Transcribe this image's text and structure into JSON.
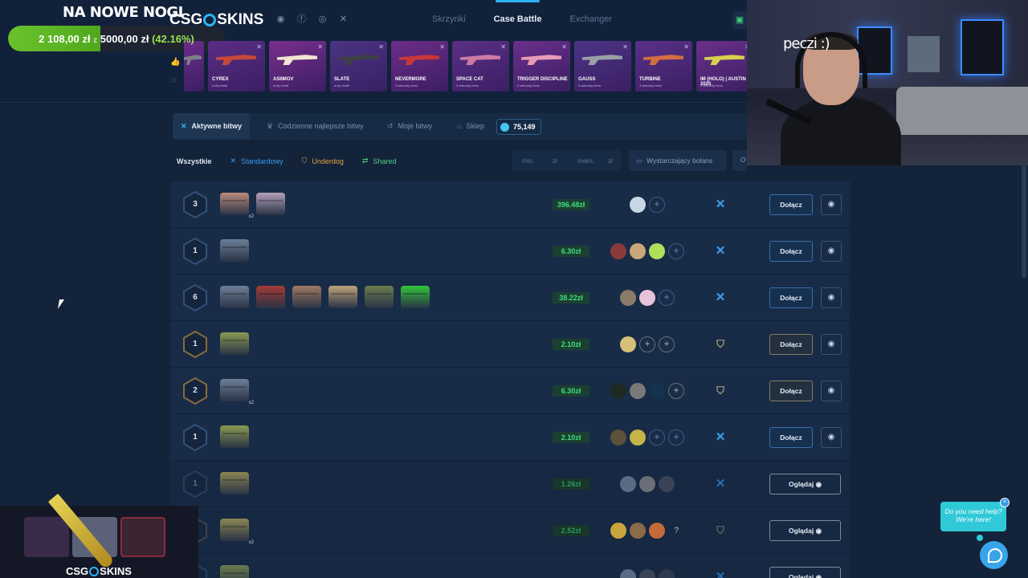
{
  "goal": {
    "title": "NA NOWE NOGI",
    "current": "2 108,00 zł",
    "of": "z",
    "target": "5000,00 zł",
    "percent": "(42.16%)",
    "fraction": 0.4216
  },
  "brand": {
    "left": "CSG",
    "right": "SKINS"
  },
  "socials": [
    "discord-icon",
    "facebook-icon",
    "instagram-icon",
    "x-icon"
  ],
  "nav": {
    "cases": "Skrzynki",
    "case_battle": "Case Battle",
    "exchanger": "Exchanger"
  },
  "drops": [
    {
      "name": "",
      "sub": "",
      "color": "#6d2c8c",
      "gun": "#7b7f86"
    },
    {
      "name": "CYREX",
      "sub": "w tej chwili",
      "color": "#5b2d86",
      "gun": "#c54a3a"
    },
    {
      "name": "ASIIMOV",
      "sub": "w tej chwili",
      "color": "#7a2e8d",
      "gun": "#f0e6d2"
    },
    {
      "name": "SLATE",
      "sub": "w tej chwili",
      "color": "#4a3483",
      "gun": "#3d4147"
    },
    {
      "name": "NEVERMORE",
      "sub": "3 sekundy temu",
      "color": "#6e2c88",
      "gun": "#c8373a"
    },
    {
      "name": "SPACE CAT",
      "sub": "3 sekundy temu",
      "color": "#5c2f87",
      "gun": "#d07aa6"
    },
    {
      "name": "TRIGGER DISCIPLINE",
      "sub": "3 sekundy temu",
      "color": "#6a2f8c",
      "gun": "#e89bb6"
    },
    {
      "name": "GAUSS",
      "sub": "3 sekundy temu",
      "color": "#4e3386",
      "gun": "#9aa0a8"
    },
    {
      "name": "TURBINE",
      "sub": "3 sekundy temu",
      "color": "#5a3188",
      "gun": "#d36d42"
    },
    {
      "name": "IM (HOLO) | AUSTIN 2025",
      "sub": "3 sekundy temu",
      "color": "#6c2f8c",
      "gun": "#d7d14d"
    }
  ],
  "tabs": {
    "active": "Aktywne bitwy",
    "daily": "Codzienne najlepsze bitwy",
    "mine": "Moje bitwy",
    "shop": "Sklep",
    "coins": "75,149"
  },
  "filters": {
    "all": "Wszystkie",
    "standard": "Standardowy",
    "underdog": "Underdog",
    "shared": "Shared",
    "min_placeholder": "min.",
    "max_placeholder": "maks.",
    "currency": "zł",
    "balance": "Wystarczający bolans",
    "edge_label": "O"
  },
  "colors": {
    "accent": "#2db4f2",
    "price": "#3ddf7c",
    "standard": "#3e9ef2",
    "underdog": "#e0a544",
    "shared": "#4bd486"
  },
  "battles": [
    {
      "rounds": "3",
      "ring": "#34507a",
      "cases": [
        {
          "c": "#b98c7c",
          "m": "x2"
        },
        {
          "c": "#b3a0b8",
          "m": ""
        }
      ],
      "price": "396.48zł",
      "players": [
        "#c8d6e6"
      ],
      "slots": 1,
      "mode": "std",
      "action": "Dołącz",
      "dim": false
    },
    {
      "rounds": "1",
      "ring": "#34507a",
      "cases": [
        {
          "c": "#6c7f98",
          "m": ""
        }
      ],
      "price": "6.30zł",
      "players": [
        "#8a3a3a",
        "#c9a77a",
        "#aee05c"
      ],
      "slots": 1,
      "mode": "std",
      "action": "Dołącz",
      "dim": false
    },
    {
      "rounds": "6",
      "ring": "#34507a",
      "cases": [
        {
          "c": "#6c7f98",
          "m": ""
        },
        {
          "c": "#a43a35",
          "m": ""
        },
        {
          "c": "#a27a64",
          "m": ""
        },
        {
          "c": "#c0a37a",
          "m": ""
        },
        {
          "c": "#6b7d4e",
          "m": ""
        },
        {
          "c": "#32c53a",
          "m": ""
        }
      ],
      "price": "38.22zł",
      "players": [
        "#8b7b6a",
        "#e6c3d8"
      ],
      "slots": 1,
      "mode": "std",
      "action": "Dołącz",
      "dim": false
    },
    {
      "rounds": "1",
      "ring": "#8a6a3c",
      "cases": [
        {
          "c": "#8a9a52",
          "m": ""
        }
      ],
      "price": "2.10zł",
      "players": [
        "#d6c07a"
      ],
      "slots": 2,
      "mode": "und",
      "action": "Dołącz",
      "dim": false
    },
    {
      "rounds": "2",
      "ring": "#8a6a3c",
      "cases": [
        {
          "c": "#6c7f98",
          "m": "x2"
        }
      ],
      "price": "6.30zł",
      "players": [
        "#1d2a22",
        "#7c7a78",
        "#12324e"
      ],
      "slots": 1,
      "mode": "und",
      "action": "Dołącz",
      "dim": false
    },
    {
      "rounds": "1",
      "ring": "#34507a",
      "cases": [
        {
          "c": "#8a9a52",
          "m": ""
        }
      ],
      "price": "2.10zł",
      "players": [
        "#5c513a",
        "#c5b446"
      ],
      "slots": 2,
      "mode": "std",
      "action": "Dołącz",
      "dim": false
    },
    {
      "rounds": "1",
      "ring": "#27405f",
      "cases": [
        {
          "c": "#8a8654",
          "m": ""
        }
      ],
      "price": "1.26zł",
      "players": [
        "#5a6c85",
        "#6c6f78",
        "#3a4456"
      ],
      "slots": 0,
      "mode": "std",
      "action": "Oglądaj",
      "dim": true
    },
    {
      "rounds": "",
      "ring": "#3d4250",
      "cases": [
        {
          "c": "#8a8654",
          "m": "x2"
        }
      ],
      "price": "2.52zł",
      "players": [
        "#c9a53c",
        "#8a6b4a",
        "#c26a3a"
      ],
      "slots": 0,
      "q": "?",
      "mode": "und",
      "action": "Oglądaj",
      "dim": true
    },
    {
      "rounds": "",
      "ring": "#27405f",
      "cases": [
        {
          "c": "#6b7d4e",
          "m": ""
        }
      ],
      "price": "",
      "players": [
        "#5a6c85",
        "#3a4456",
        "#2d3a4e"
      ],
      "slots": 0,
      "mode": "std",
      "action": "Oglądaj",
      "dim": true
    }
  ],
  "webcam": {
    "caption": "peczi :)"
  },
  "overlay": {
    "brand_left": "CSG",
    "brand_right": "SKINS"
  },
  "chat": {
    "line1": "Do you need help?",
    "line2": "We're here!",
    "close": "×"
  }
}
